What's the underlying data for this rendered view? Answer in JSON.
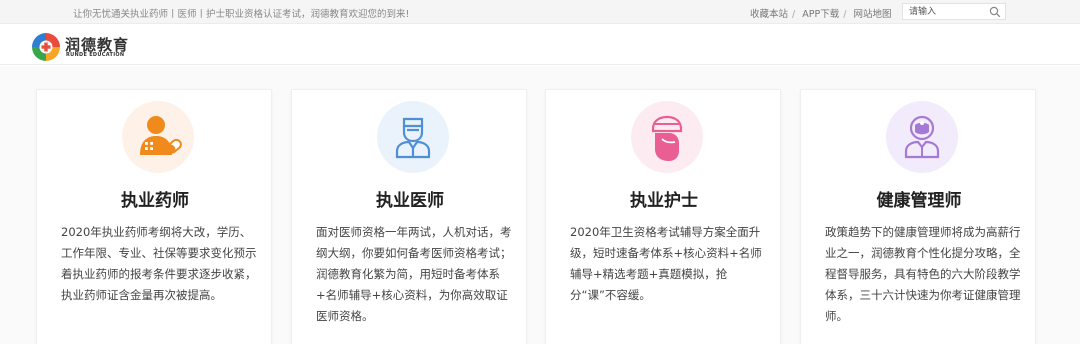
{
  "topbar": {
    "welcome": "让你无忧通关执业药师丨医师丨护士职业资格认证考试，润德教育欢迎您的到来!",
    "links": [
      "收藏本站",
      "APP下载",
      "网站地图"
    ],
    "search_placeholder": "请输入"
  },
  "header": {
    "logo_cn": "润德教育",
    "logo_en": "RUNDE EDUCATION"
  },
  "icons": {
    "pharmacist": "pharmacist-icon",
    "doctor": "doctor-icon",
    "nurse": "nurse-icon",
    "health_manager": "health-manager-icon",
    "search": "search-icon"
  },
  "colors": {
    "pharmacist": "#f08a1c",
    "doctor": "#4f8fd8",
    "nurse": "#ea5f93",
    "health_manager": "#a57ad6"
  },
  "cards": [
    {
      "title": "执业药师",
      "desc": "2020年执业药师考纲将大改，学历、工作年限、专业、社保等要求变化预示着执业药师的报考条件要求逐步收紧，执业药师证含金量再次被提高。"
    },
    {
      "title": "执业医师",
      "desc": "面对医师资格一年两试，人机对话，考纲大纲，你要如何备考医师资格考试；润德教育化繁为简，用短时备考体系+名师辅导+核心资料，为你高效取证医师资格。"
    },
    {
      "title": "执业护士",
      "desc": "2020年卫生资格考试辅导方案全面升级，短时速备考体系+核心资料+名师辅导+精选考题+真题模拟，抢分“课”不容缓。"
    },
    {
      "title": "健康管理师",
      "desc": "政策趋势下的健康管理师将成为高薪行业之一，润德教育个性化提分攻略，全程督导服务，具有特色的六大阶段教学体系，三十六计快速为你考证健康管理师。"
    }
  ]
}
